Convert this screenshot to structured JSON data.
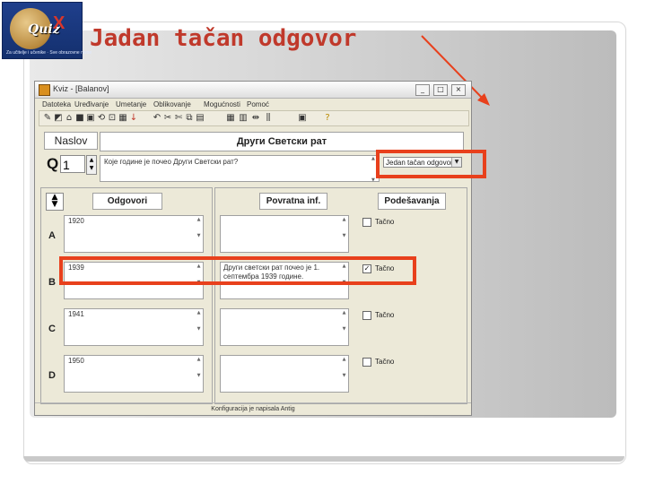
{
  "slide": {
    "title": "Jadan tačan odgovor",
    "logo": {
      "word": "Quiz",
      "mark": "X",
      "caption": "Za učitelje i učenike · Sve obrazovne nivoe"
    }
  },
  "app": {
    "window_title": "Kviz - [Balanov]",
    "window_buttons": [
      "_",
      "□",
      "×"
    ],
    "menu": [
      "Datoteka",
      "Uređivanje",
      "Umetanje",
      "Oblikovanje",
      "Mogućnosti",
      "Pomoć"
    ],
    "toolbar_icons": [
      "wand-icon",
      "open-folder-icon",
      "save-icon",
      "save-as-icon",
      "undo-icon",
      "import-icon",
      "export-icon",
      "arrow-down-icon",
      "cut-icon",
      "scissors-icon",
      "copy-icon",
      "paste-icon",
      "grid-icon",
      "table-icon",
      "merge-icon",
      "split-icon",
      "picture-icon",
      "help-icon"
    ],
    "naslov_label": "Naslov",
    "heading_value": "Други Светски рат",
    "q_label": "Q",
    "question_number": "1",
    "question_text": "Које године је почео Други Светски рат?",
    "answer_type": "Jedan tačan odgovor",
    "columns": {
      "answers": "Odgovori",
      "feedback": "Povratna inf.",
      "settings": "Podešavanja"
    },
    "rows": [
      {
        "letter": "A",
        "answer": "1920",
        "feedback": "",
        "correct_label": "Tačno",
        "checked": false
      },
      {
        "letter": "B",
        "answer": "1939",
        "feedback": "Други светски рат почео је 1. септембра 1939 године.",
        "correct_label": "Tačno",
        "checked": true
      },
      {
        "letter": "C",
        "answer": "1941",
        "feedback": "",
        "correct_label": "Tačno",
        "checked": false
      },
      {
        "letter": "D",
        "answer": "1950",
        "feedback": "",
        "correct_label": "Tačno",
        "checked": false
      }
    ],
    "status": "Konfiguracija je napisala Antig"
  },
  "colors": {
    "title": "#c0392b",
    "highlight": "#e8401c",
    "window_bg": "#ece9d8"
  }
}
